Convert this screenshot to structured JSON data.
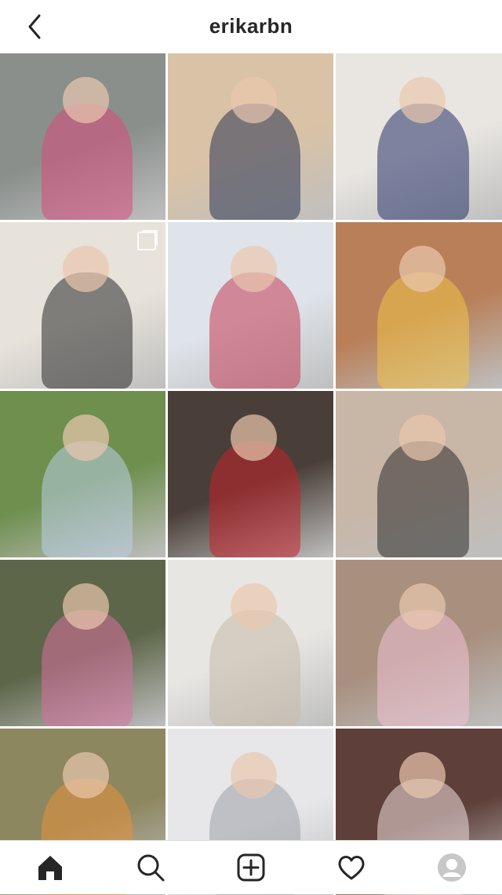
{
  "header": {
    "username": "erikarbn"
  },
  "grid": {
    "tiles": [
      {
        "bg": "#8a8f8c",
        "accent": "#d94a7a",
        "multi": false
      },
      {
        "bg": "#d9c2a5",
        "accent": "#2a3454",
        "multi": false
      },
      {
        "bg": "#e9e6e2",
        "accent": "#253168",
        "multi": false
      },
      {
        "bg": "#e7e2da",
        "accent": "#2a2a2a",
        "multi": true
      },
      {
        "bg": "#dfe4ea",
        "accent": "#c23d55",
        "multi": false
      },
      {
        "bg": "#b97f58",
        "accent": "#f1c44a",
        "multi": false
      },
      {
        "bg": "#6e8f4e",
        "accent": "#bcd0e8",
        "multi": false
      },
      {
        "bg": "#4a3f38",
        "accent": "#c4232b",
        "multi": false
      },
      {
        "bg": "#c8b6a6",
        "accent": "#2b2b2b",
        "multi": false
      },
      {
        "bg": "#5d6648",
        "accent": "#d86fa0",
        "multi": false
      },
      {
        "bg": "#e8e6e3",
        "accent": "#c4b9a8",
        "multi": false
      },
      {
        "bg": "#a88f7e",
        "accent": "#f1c3d4",
        "multi": false
      },
      {
        "bg": "#8d8760",
        "accent": "#e8913a",
        "multi": false
      },
      {
        "bg": "#e7e7ea",
        "accent": "#9ea0a8",
        "multi": false
      },
      {
        "bg": "#5f3f3a",
        "accent": "#f0e0df",
        "multi": false
      }
    ]
  },
  "nav": {
    "items": [
      "home-icon",
      "search-icon",
      "new-post-icon",
      "activity-heart-icon",
      "profile-avatar-icon"
    ]
  },
  "colors": {
    "text": "#262626",
    "border": "#dbdbdb",
    "icon": "#262626"
  }
}
